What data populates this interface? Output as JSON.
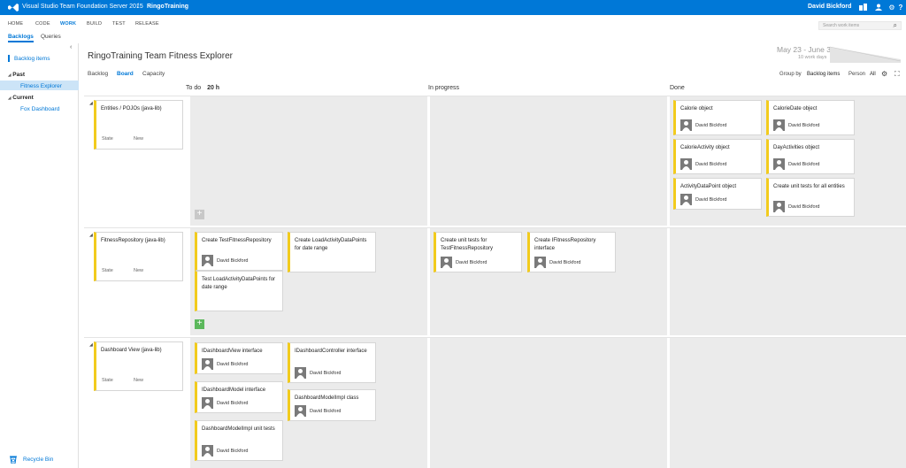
{
  "topbar": {
    "product": "Visual Studio Team Foundation Server 2015",
    "separator": "/",
    "project": "RingoTraining",
    "user": "David Bickford"
  },
  "hub": {
    "items": [
      "HOME",
      "CODE",
      "WORK",
      "BUILD",
      "TEST",
      "RELEASE"
    ],
    "active": "WORK",
    "search_placeholder": "Search work items"
  },
  "subtabs": {
    "items": [
      "Backlogs",
      "Queries"
    ],
    "active": "Backlogs"
  },
  "sidebar": {
    "backlog_items": "Backlog items",
    "past_header": "Past",
    "past_items": [
      "Fitness Explorer"
    ],
    "current_header": "Current",
    "current_items": [
      "Fox Dashboard"
    ],
    "recycle": "Recycle Bin"
  },
  "main": {
    "title": "RingoTraining Team Fitness Explorer",
    "pivots": [
      "Backlog",
      "Board",
      "Capacity"
    ],
    "active_pivot": "Board",
    "date_range": "May 23 - June 3",
    "work_days": "10 work days",
    "group_by_label": "Group by",
    "group_by_value": "Backlog items",
    "person_label": "Person",
    "person_value": "All"
  },
  "columns": [
    {
      "name": "To do",
      "hours": "20 h"
    },
    {
      "name": "In progress"
    },
    {
      "name": "Done"
    }
  ],
  "lanes": [
    {
      "title": "Entities / POJOs (java-lib)",
      "state_label": "State",
      "state": "New",
      "todo": [],
      "inprogress": [],
      "done": [
        {
          "title": "Calorie object",
          "assignee": "David Bickford"
        },
        {
          "title": "CalorieDate object",
          "assignee": "David Bickford"
        },
        {
          "title": "CalorieActivity object",
          "assignee": "David Bickford"
        },
        {
          "title": "DayActivities object",
          "assignee": "David Bickford"
        },
        {
          "title": "ActivityDataPoint object",
          "assignee": "David Bickford"
        },
        {
          "title": "Create unit tests for all entities",
          "assignee": "David Bickford"
        }
      ]
    },
    {
      "title": "FitnessRepository (java-lib)",
      "state_label": "State",
      "state": "New",
      "todo": [
        {
          "title": "Create TestFitnessRepository",
          "assignee": "David Bickford"
        },
        {
          "title": "Create LoadActivityDataPoints for date range",
          "assignee": ""
        },
        {
          "title": "Test LoadActivityDataPoints for date range",
          "assignee": ""
        }
      ],
      "inprogress": [
        {
          "title": "Create unit tests for TestFitnessRepository",
          "assignee": "David Bickford"
        },
        {
          "title": "Create IFitnessRepository interface",
          "assignee": "David Bickford"
        }
      ],
      "done": []
    },
    {
      "title": "Dashboard View (java-lib)",
      "state_label": "State",
      "state": "New",
      "todo": [
        {
          "title": "IDashboardView interface",
          "assignee": "David Bickford"
        },
        {
          "title": "IDashboardController interface",
          "assignee": "David Bickford"
        },
        {
          "title": "IDashboardModel interface",
          "assignee": "David Bickford"
        },
        {
          "title": "DashboardModelImpl class",
          "assignee": "David Bickford"
        },
        {
          "title": "DashboardModelImpl unit tests",
          "assignee": "David Bickford"
        }
      ],
      "inprogress": [],
      "done": []
    }
  ],
  "colors": {
    "accent": "#0078d7",
    "card_stripe": "#f2cb1d",
    "add_active": "#5cb85c",
    "add_inactive": "#c8c8c8"
  }
}
